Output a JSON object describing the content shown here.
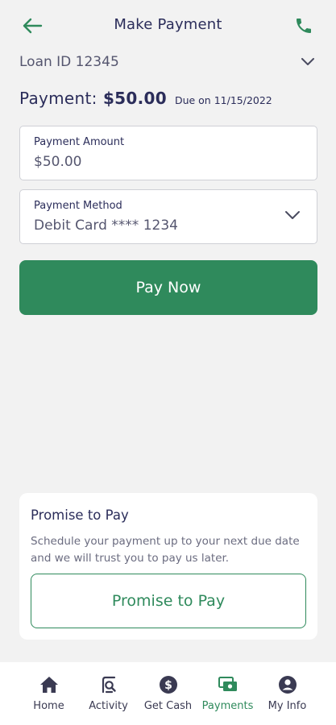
{
  "header": {
    "title": "Make Payment"
  },
  "loan": {
    "label": "Loan ID 12345"
  },
  "summary": {
    "payment_label": "Payment:",
    "payment_amount": "$50.00",
    "due_text": "Due on 11/15/2022"
  },
  "amount_field": {
    "label": "Payment Amount",
    "value": "$50.00"
  },
  "method_field": {
    "label": "Payment Method",
    "value": "Debit Card **** 1234"
  },
  "pay_button": {
    "label": "Pay Now"
  },
  "promise": {
    "title": "Promise to Pay",
    "description": "Schedule your payment up to your next due date and we will trust you to pay us later.",
    "button_label": "Promise to Pay"
  },
  "nav": {
    "items": [
      {
        "label": "Home",
        "icon": "home-icon"
      },
      {
        "label": "Activity",
        "icon": "activity-icon"
      },
      {
        "label": "Get Cash",
        "icon": "dollar-icon"
      },
      {
        "label": "Payments",
        "icon": "payments-icon",
        "active": true
      },
      {
        "label": "My Info",
        "icon": "user-icon"
      }
    ]
  },
  "colors": {
    "brand_green": "#2f8a5c",
    "text_navy": "#2b2d5a",
    "background": "#f2f2f2"
  }
}
